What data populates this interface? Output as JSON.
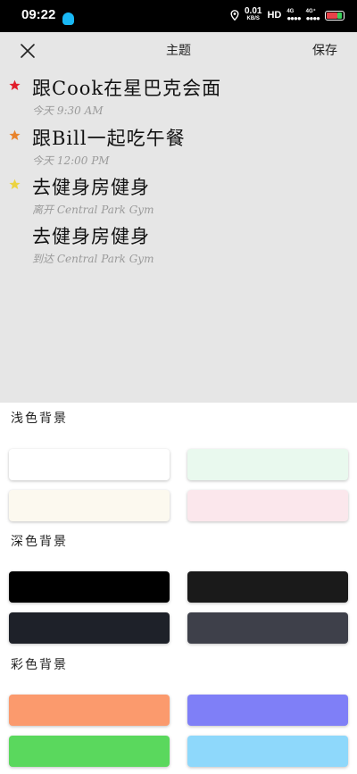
{
  "status_bar": {
    "time": "09:22",
    "speed_value": "0.01",
    "speed_unit": "KB/S",
    "hd": "HD",
    "signal1": "4G",
    "signal2": "4G⁺",
    "app_icon": "qq-icon"
  },
  "toolbar": {
    "close_icon": "close-icon",
    "title": "主题",
    "save_label": "保存"
  },
  "reminders": [
    {
      "title": "跟Cook在星巴克会面",
      "subtitle": "今天 9:30 AM",
      "star_color": "#e11d2a"
    },
    {
      "title": "跟Bill一起吃午餐",
      "subtitle": "今天 12:00 PM",
      "star_color": "#e8832c"
    },
    {
      "title": "去健身房健身",
      "subtitle": "离开 Central Park Gym",
      "star_color": "#ecd340"
    },
    {
      "title": "去健身房健身",
      "subtitle": "到达 Central Park Gym",
      "star_color": ""
    }
  ],
  "sections": {
    "light": {
      "label": "浅色背景",
      "colors": [
        "#ffffff",
        "#e9f9ee",
        "#fcf9ef",
        "#fbe7ec"
      ]
    },
    "dark": {
      "label": "深色背景",
      "colors": [
        "#000000",
        "#1a1a1a",
        "#1e2129",
        "#3e404a"
      ]
    },
    "color": {
      "label": "彩色背景",
      "colors": [
        "#fb9a6d",
        "#7f7ff7",
        "#5ad85d",
        "#8ed8fb"
      ]
    }
  }
}
